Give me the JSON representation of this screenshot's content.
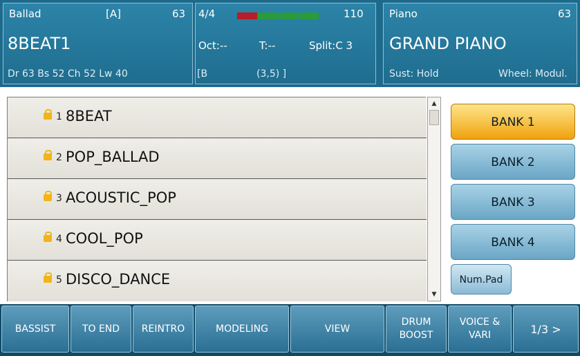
{
  "style_panel": {
    "category": "Ballad",
    "bank_letter": "[A]",
    "tempo_index": "63",
    "style_name": "8BEAT1",
    "volumes": "Dr 63  Bs 52  Ch 52  Lw 40"
  },
  "mid_panel": {
    "time_signature": "4/4",
    "tempo": "110",
    "octave": "Oct:--",
    "transpose": "T:--",
    "split": "Split:C 3",
    "measure": "[B",
    "position": "(3,5) ]",
    "meter_colors": [
      "#b51d2a",
      "#2a9b3a",
      "#2a9b3a",
      "#2a9b3a"
    ]
  },
  "voice_panel": {
    "category": "Piano",
    "number": "63",
    "voice_name": "GRAND PIANO",
    "sustain": "Sust: Hold",
    "wheel": "Wheel: Modul."
  },
  "list": {
    "items": [
      {
        "num": "1",
        "name": "8BEAT"
      },
      {
        "num": "2",
        "name": "POP_BALLAD"
      },
      {
        "num": "3",
        "name": "ACOUSTIC_POP"
      },
      {
        "num": "4",
        "name": "COOL_POP"
      },
      {
        "num": "5",
        "name": "DISCO_DANCE"
      }
    ]
  },
  "banks": [
    {
      "label": "BANK 1",
      "active": true
    },
    {
      "label": "BANK 2",
      "active": false
    },
    {
      "label": "BANK 3",
      "active": false
    },
    {
      "label": "BANK 4",
      "active": false
    }
  ],
  "numpad": "Num.Pad",
  "bottom": {
    "bassist": "BASSIST",
    "to_end": "TO END",
    "reintro": "REINTRO",
    "modeling": "MODELING",
    "view": "VIEW",
    "drum_boost_1": "DRUM",
    "drum_boost_2": "BOOST",
    "voice_vari_1": "VOICE &",
    "voice_vari_2": "VARI",
    "page": "1/3 >"
  },
  "colors": {
    "accent": "#f0a20e",
    "panel": "#1f6d8f"
  }
}
